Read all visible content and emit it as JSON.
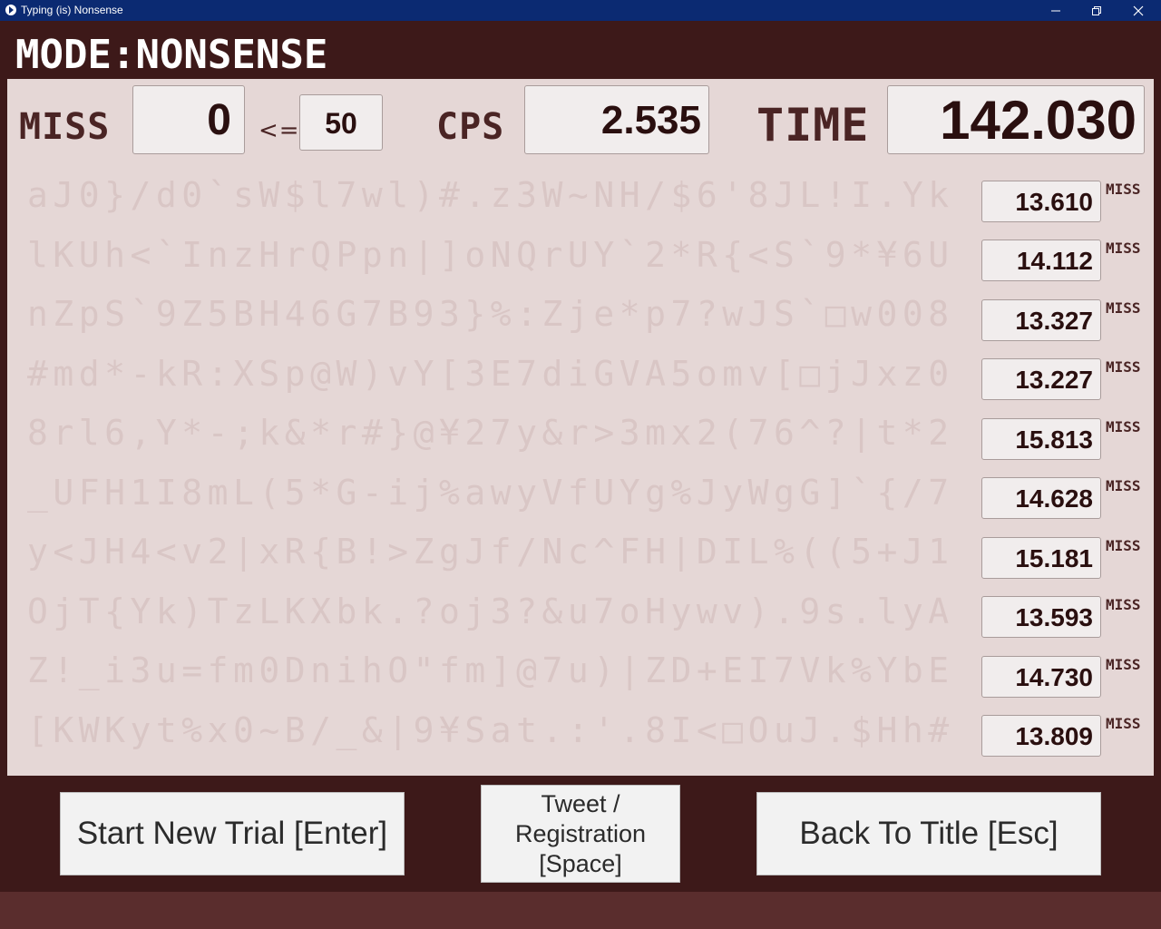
{
  "window": {
    "title": "Typing (is) Nonsense"
  },
  "header": {
    "mode": "MODE:NONSENSE"
  },
  "stats": {
    "miss_label": "MISS",
    "miss_value": "0",
    "le_label": "<=",
    "miss_limit": "50",
    "cps_label": "CPS",
    "cps_value": "2.535",
    "time_label": "TIME",
    "time_value": "142.030"
  },
  "rows": [
    {
      "text": "aJ0}/d0`sW$l7wl)#.z3W~NH/$6'8JL!I.Yk",
      "time": "13.610",
      "miss": "MISS"
    },
    {
      "text": "lKUh<`InzHrQPpn|]oNQrUY`2*R{<S`9*¥6U",
      "time": "14.112",
      "miss": "MISS"
    },
    {
      "text": "nZpS`9Z5BH46G7B93}%:Zje*p7?wJS`□w008",
      "time": "13.327",
      "miss": "MISS"
    },
    {
      "text": "#md*-kR:XSp@W)vY[3E7diGVA5omv[□jJxz0",
      "time": "13.227",
      "miss": "MISS"
    },
    {
      "text": "8rl6,Y*-;k&*r#}@¥27y&r>3mx2(76^?|t*2",
      "time": "15.813",
      "miss": "MISS"
    },
    {
      "text": "_UFH1I8mL(5*G-ij%awyVfUYg%JyWgG]`{/7",
      "time": "14.628",
      "miss": "MISS"
    },
    {
      "text": "y<JH4<v2|xR{B!>ZgJf/Nc^FH|DIL%((5+J1",
      "time": "15.181",
      "miss": "MISS"
    },
    {
      "text": "OjT{Yk)TzLKXbk.?oj3?&u7oHywv).9s.lyA",
      "time": "13.593",
      "miss": "MISS"
    },
    {
      "text": "Z!_i3u=fm0DnihO\"fm]@7u)|ZD+EI7Vk%YbE",
      "time": "14.730",
      "miss": "MISS"
    },
    {
      "text": "[KWKyt%x0~B/_&|9¥Sat.:'.8I<□OuJ.$Hh#",
      "time": "13.809",
      "miss": "MISS"
    }
  ],
  "buttons": {
    "start": "Start New Trial [Enter]",
    "tweet_line1": "Tweet /",
    "tweet_line2": "Registration",
    "tweet_line3": "[Space]",
    "back": "Back To Title [Esc]"
  },
  "colors": {
    "titlebar": "#0b2a72",
    "app_bg": "#3d1919",
    "panel_bg": "#e5d7d6",
    "accent_text": "#4a2424"
  }
}
